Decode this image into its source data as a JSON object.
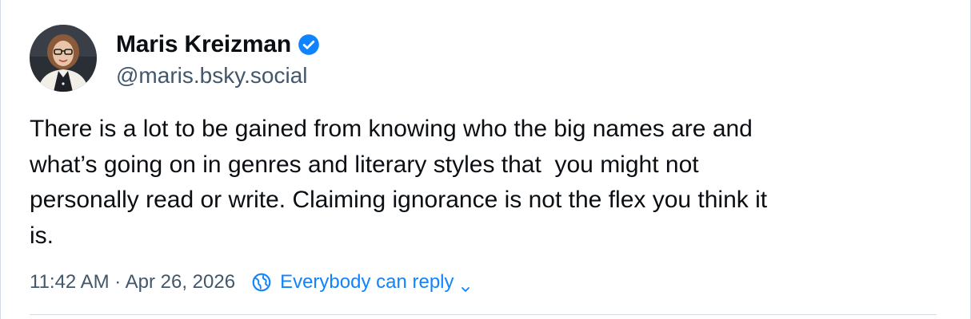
{
  "post": {
    "author": {
      "display_name": "Maris Kreizman",
      "handle": "@maris.bsky.social",
      "verified": true,
      "avatar": "profile-photo"
    },
    "text": "There is a lot to be gained from knowing who the big names are and\nwhat’s going on in genres and literary styles that  you might not\npersonally read or write. Claiming ignorance is not the flex you think it\nis.",
    "timestamp": "11:42 AM · Apr 26, 2026",
    "reply_setting": {
      "label": "Everybody can reply",
      "icon": "globe-icon"
    }
  },
  "colors": {
    "text": "#0b0f14",
    "secondary_text": "#42576c",
    "accent": "#1083fe",
    "divider": "#d4dbe2",
    "background": "#ffffff"
  }
}
